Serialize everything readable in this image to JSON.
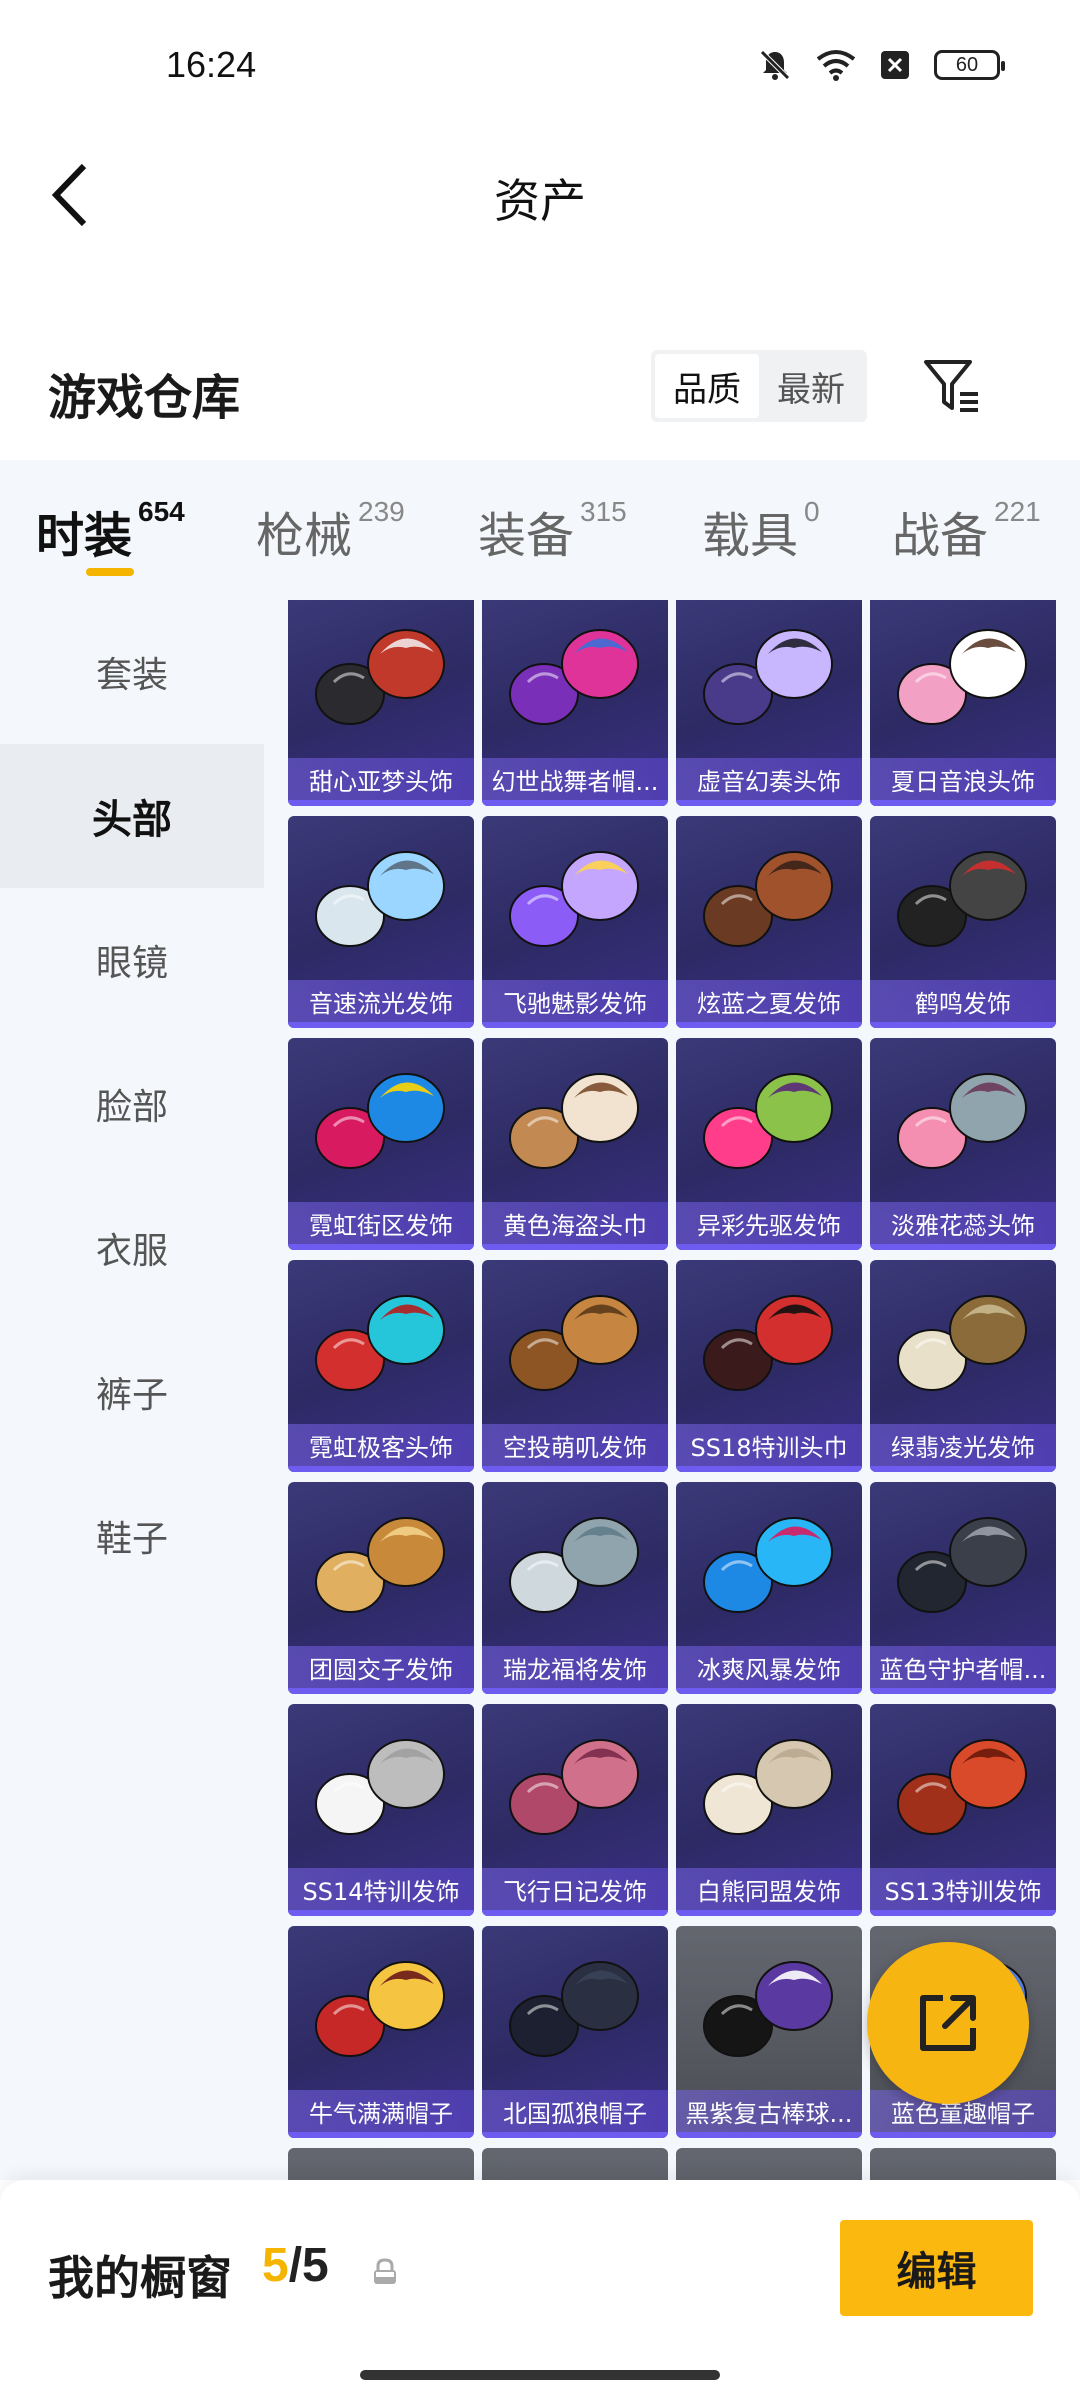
{
  "status_bar": {
    "time": "16:24",
    "battery": "60"
  },
  "header": {
    "title": "资产"
  },
  "warehouse": {
    "title": "游戏仓库",
    "sort_options": [
      "品质",
      "最新"
    ],
    "sort_selected": "品质"
  },
  "category_tabs": [
    {
      "label": "时装",
      "count": "654"
    },
    {
      "label": "枪械",
      "count": "239"
    },
    {
      "label": "装备",
      "count": "315"
    },
    {
      "label": "载具",
      "count": "0"
    },
    {
      "label": "战备",
      "count": "221"
    }
  ],
  "active_tab": "时装",
  "sidebar": {
    "items": [
      "套装",
      "头部",
      "眼镜",
      "脸部",
      "衣服",
      "裤子",
      "鞋子"
    ],
    "active": "头部"
  },
  "items": [
    {
      "name": "甜心亚梦头饰",
      "icon": "cat-ear-hat-icon"
    },
    {
      "name": "幻世战舞者帽...",
      "icon": "bucket-hat-icon"
    },
    {
      "name": "虚音幻奏头饰",
      "icon": "headphone-hair-icon"
    },
    {
      "name": "夏日音浪头饰",
      "icon": "pink-cap-icon"
    },
    {
      "name": "音速流光发饰",
      "icon": "visor-hair-icon"
    },
    {
      "name": "飞驰魅影发饰",
      "icon": "purple-hair-icon"
    },
    {
      "name": "炫蓝之夏发饰",
      "icon": "brown-hair-icon"
    },
    {
      "name": "鹤鸣发饰",
      "icon": "black-bun-icon"
    },
    {
      "name": "霓虹街区发饰",
      "icon": "shutter-shades-hair-icon"
    },
    {
      "name": "黄色海盗头巾",
      "icon": "bandana-icon"
    },
    {
      "name": "异彩先驱发饰",
      "icon": "pink-neon-hair-icon"
    },
    {
      "name": "淡雅花蕊头饰",
      "icon": "top-hat-icon"
    },
    {
      "name": "霓虹极客头饰",
      "icon": "teal-cap-icon"
    },
    {
      "name": "空投萌叽发饰",
      "icon": "bob-hair-icon"
    },
    {
      "name": "SS18特训头巾",
      "icon": "star-bandana-icon"
    },
    {
      "name": "绿翡凌光发饰",
      "icon": "veil-hair-icon"
    },
    {
      "name": "团圆交子发饰",
      "icon": "blonde-pigtails-icon"
    },
    {
      "name": "瑞龙福将发饰",
      "icon": "silver-dragon-hair-icon"
    },
    {
      "name": "冰爽风暴发饰",
      "icon": "blue-pigtails-icon"
    },
    {
      "name": "蓝色守护者帽...",
      "icon": "military-cap-icon"
    },
    {
      "name": "SS14特训发饰",
      "icon": "white-hair-icon"
    },
    {
      "name": "飞行日记发饰",
      "icon": "pink-curly-hair-icon"
    },
    {
      "name": "白熊同盟发饰",
      "icon": "cream-hair-icon"
    },
    {
      "name": "SS13特训发饰",
      "icon": "red-bow-hair-icon"
    },
    {
      "name": "牛气满满帽子",
      "icon": "ox-hat-icon"
    },
    {
      "name": "北国孤狼帽子",
      "icon": "beanie-icon"
    },
    {
      "name": "黑紫复古棒球...",
      "icon": "baseball-cap-icon"
    },
    {
      "name": "蓝色童趣帽子",
      "icon": "blue-kids-hat-icon"
    }
  ],
  "bottom": {
    "showcase_label": "我的橱窗",
    "showcase_current": "5",
    "showcase_sep": "/",
    "showcase_max": "5",
    "edit_label": "编辑"
  },
  "colors": {
    "accent": "#f5b400",
    "card_bg": "#2f2c6a",
    "card_gray": "#565860"
  }
}
